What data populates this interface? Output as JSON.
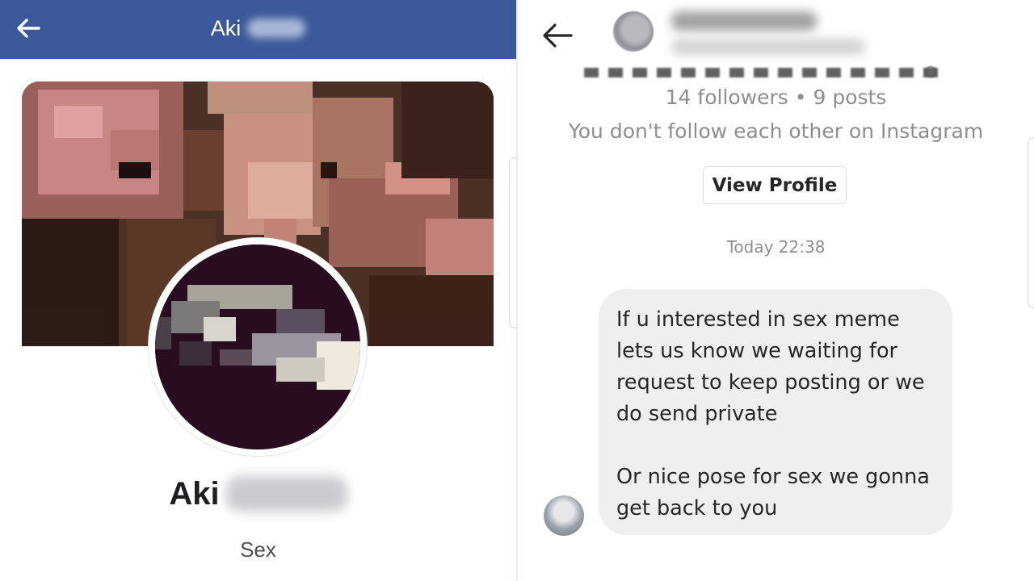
{
  "facebook": {
    "header": {
      "title": "Aki",
      "back_icon": "back-arrow-icon"
    },
    "profile": {
      "name": "Aki",
      "subtitle": "Sex"
    },
    "colors": {
      "header_bg": "#3b5998",
      "header_text": "#ffffff"
    }
  },
  "instagram": {
    "header": {
      "back_icon": "back-arrow-icon"
    },
    "stats": "14 followers • 9 posts",
    "follow_note": "You don't follow each other on Instagram",
    "view_profile_label": "View Profile",
    "timestamp": "Today 22:38",
    "message": "If u interested in sex meme\nlets us know we waiting for\nrequest to keep posting or we\ndo send private\n\nOr nice pose for sex we gonna\nget back to you",
    "colors": {
      "bubble_bg": "#efefef",
      "muted_text": "#8e8e8e"
    }
  }
}
